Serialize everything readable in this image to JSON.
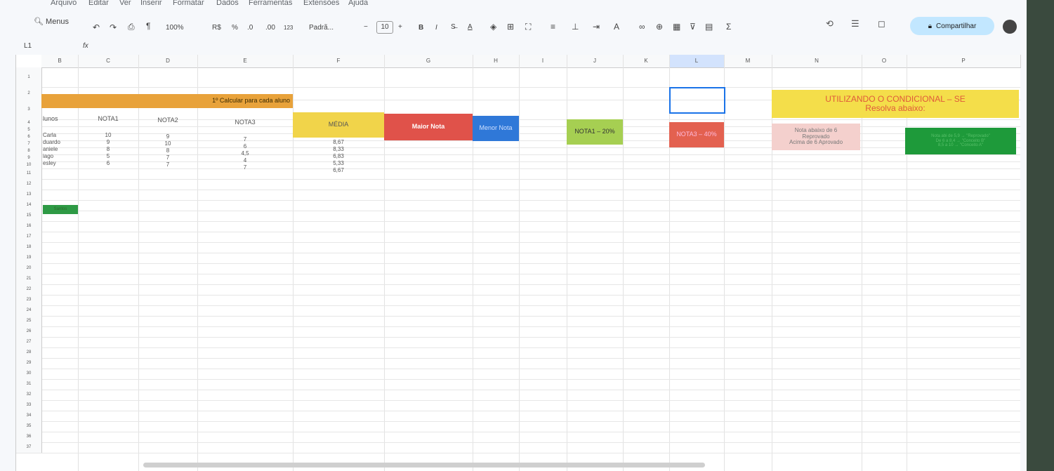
{
  "menu": [
    "Arquivo",
    "Editar",
    "Ver",
    "Inserir",
    "Formatar",
    "Dados",
    "Ferramentas",
    "Extensões",
    "Ajuda"
  ],
  "toolbar": {
    "menus_label": "Menus",
    "zoom": "100%",
    "currency": "R$",
    "percent": "%",
    "dec_decrease": ".0",
    "dec_increase": ".00",
    "number_format": "123",
    "font": "Padrã...",
    "font_size": "10",
    "bold": "B",
    "italic": "I"
  },
  "share_label": "Compartilhar",
  "formula_bar": {
    "name_box": "L1",
    "fx": "fx"
  },
  "columns": [
    "B",
    "C",
    "D",
    "E",
    "F",
    "G",
    "H",
    "I",
    "J",
    "K",
    "L",
    "M",
    "N",
    "O",
    "P"
  ],
  "rows": [
    "1",
    "2",
    "3",
    "4",
    "5",
    "6",
    "7",
    "8",
    "9",
    "10",
    "11",
    "12",
    "13",
    "14",
    "15",
    "16",
    "17",
    "18",
    "19",
    "20",
    "21",
    "22",
    "23",
    "24",
    "25",
    "26",
    "27",
    "28",
    "29",
    "30",
    "31",
    "32",
    "33",
    "34",
    "35",
    "36",
    "37"
  ],
  "sheet": {
    "banner": "1º Calcular para cada aluno",
    "headers": {
      "alunos": "lunos",
      "nota1": "NOTA1",
      "nota2": "NOTA2",
      "nota3": "NOTA3",
      "media": "MÉDIA",
      "maior": "Maior Nota",
      "menor": "Menor Nota",
      "nota1_pct": "NOTA1 – 20%",
      "nota3_pct": "NOTA3 – 40%"
    },
    "students": [
      {
        "name": "Carla",
        "n1": "10",
        "n2": "9",
        "n3": "7",
        "media": "8,67"
      },
      {
        "name": "duardo",
        "n1": "9",
        "n2": "10",
        "n3": "6",
        "media": "8,33"
      },
      {
        "name": "aniele",
        "n1": "8",
        "n2": "8",
        "n3": "4,5",
        "media": "6,83"
      },
      {
        "name": "iago",
        "n1": "5",
        "n2": "7",
        "n3": "4",
        "media": "5,33"
      },
      {
        "name": "esley",
        "n1": "6",
        "n2": "7",
        "n3": "7",
        "media": "6,67"
      }
    ],
    "green_tag": "Santos",
    "cond_title": "UTILIZANDO O CONDICIONAL – SE",
    "cond_subtitle": "Resolva abaixo:",
    "cond_rule1": [
      "Nota abaixo de 6",
      "Reprovado",
      "Acima de 6 Aprovado"
    ],
    "cond_rule2": [
      "Nota abi de 5,9 → \"Reprovado\"",
      "De 6 a 8,4 → \"Conceito B\"",
      "8,5 a 10 → \"Conceito A\""
    ]
  },
  "colors": {
    "banner": "#e8a23a",
    "media": "#f1d44a",
    "maior": "#e0524a",
    "menor": "#2f78d8",
    "nota1pct": "#a6cf52",
    "nota3pct": "#e36150",
    "cond": "#f4de4a",
    "cond_text": "#e05a3a",
    "rule1": "#f4d0cd",
    "rule2": "#1e9a3a",
    "tag": "#2e9a45"
  }
}
